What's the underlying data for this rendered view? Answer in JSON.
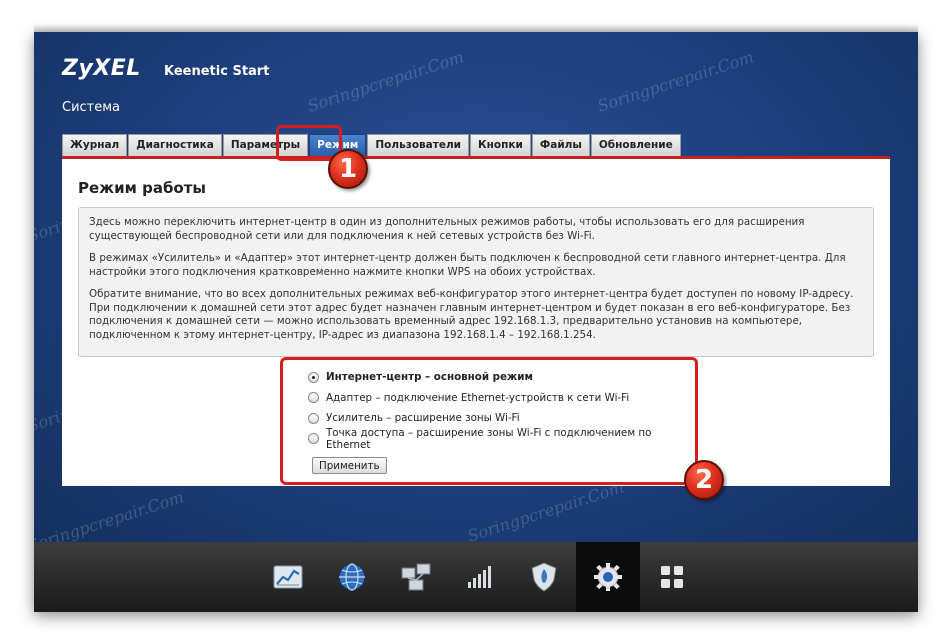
{
  "header": {
    "logo": "ZyXEL",
    "product": "Keenetic Start",
    "section": "Система"
  },
  "tabs": [
    {
      "label": "Журнал"
    },
    {
      "label": "Диагностика"
    },
    {
      "label": "Параметры"
    },
    {
      "label": "Режим",
      "active": true
    },
    {
      "label": "Пользователи"
    },
    {
      "label": "Кнопки"
    },
    {
      "label": "Файлы"
    },
    {
      "label": "Обновление"
    }
  ],
  "page": {
    "title": "Режим работы",
    "info": [
      "Здесь можно переключить интернет-центр в один из дополнительных режимов работы, чтобы использовать его для расширения существующей беспроводной сети или для подключения к ней сетевых устройств без Wi-Fi.",
      "В режимах «Усилитель» и «Адаптер» этот интернет-центр должен быть подключен к беспроводной сети главного интернет-центра. Для настройки этого подключения кратковременно нажмите кнопки WPS на обоих устройствах.",
      "Обратите внимание, что во всех дополнительных режимах веб-конфигуратор этого интернет-центра будет доступен по новому IP-адресу. При подключении к домашней сети этот адрес будет назначен главным интернет-центром и будет показан в его веб-конфигураторе. Без подключения к домашней сети — можно использовать временный адрес 192.168.1.3, предварительно установив на компьютере, подключенном к этому интернет-центру, IP-адрес из диапазона 192.168.1.4 – 192.168.1.254."
    ],
    "modes": [
      {
        "label": "Интернет-центр – основной режим",
        "selected": true
      },
      {
        "label": "Адаптер – подключение Ethernet-устройств к сети Wi-Fi",
        "selected": false
      },
      {
        "label": "Усилитель – расширение зоны Wi-Fi",
        "selected": false
      },
      {
        "label": "Точка доступа – расширение зоны Wi-Fi с подключением по Ethernet",
        "selected": false
      }
    ],
    "apply_label": "Применить"
  },
  "annotations": {
    "badge1": "1",
    "badge2": "2"
  },
  "watermark": "Soringpcrepair.Com",
  "dock": [
    {
      "icon": "chart-icon"
    },
    {
      "icon": "globe-icon"
    },
    {
      "icon": "network-icon"
    },
    {
      "icon": "signal-bars-icon"
    },
    {
      "icon": "shield-icon"
    },
    {
      "icon": "gear-icon",
      "active": true
    },
    {
      "icon": "grid-icon"
    }
  ],
  "colors": {
    "accent_red": "#c22222",
    "tab_active": "#2a5ea8",
    "frame_blue": "#1d3e7c"
  }
}
